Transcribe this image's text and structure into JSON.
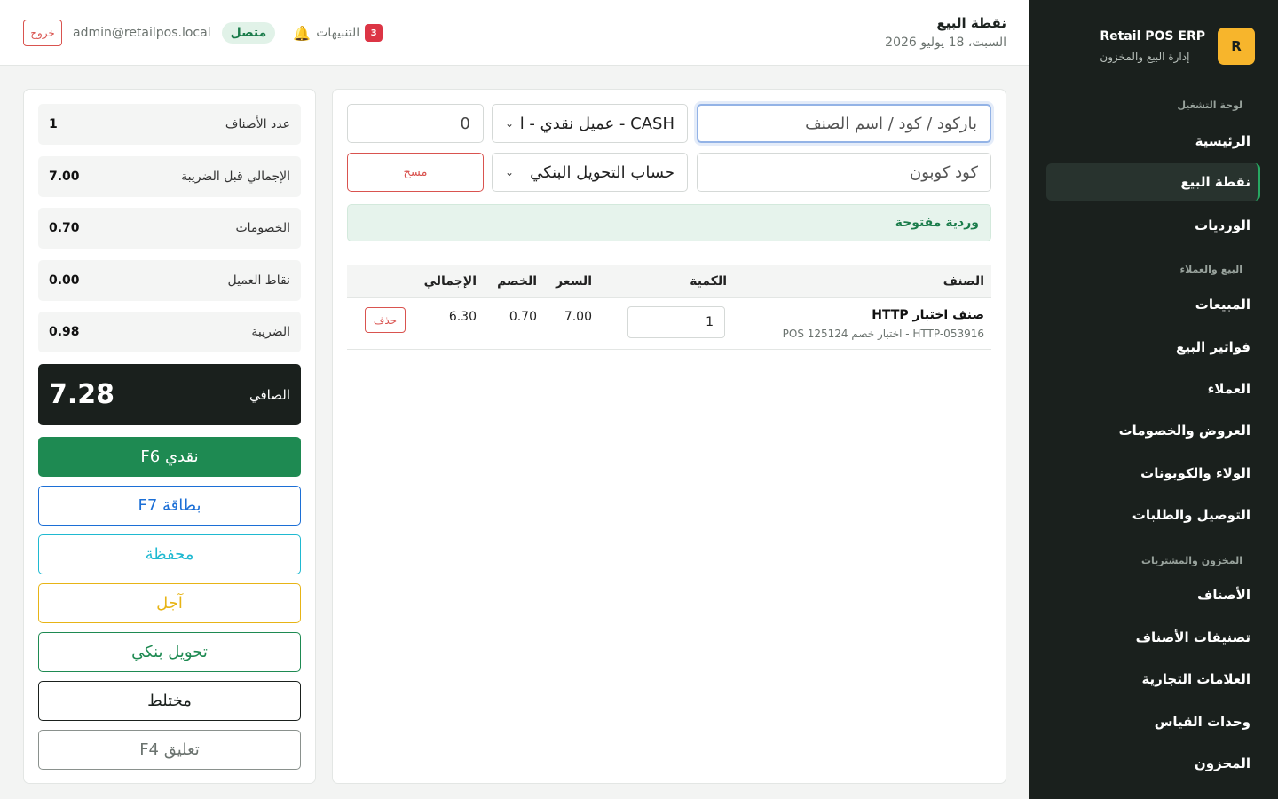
{
  "sidebar": {
    "brand_logo": "R",
    "brand_name": "Retail POS ERP",
    "brand_sub": "إدارة البيع والمخزون",
    "sections": {
      "dashboard": "لوحة التشغيل",
      "sales_customers": "البيع والعملاء",
      "inventory_purchases": "المخزون والمشتريات"
    },
    "items": [
      {
        "label": "الرئيسية"
      },
      {
        "label": "نقطة البيع"
      },
      {
        "label": "الورديات"
      },
      {
        "label": "المبيعات"
      },
      {
        "label": "فواتير البيع"
      },
      {
        "label": "العملاء"
      },
      {
        "label": "العروض والخصومات"
      },
      {
        "label": "الولاء والكوبونات"
      },
      {
        "label": "التوصيل والطلبات"
      },
      {
        "label": "الأصناف"
      },
      {
        "label": "تصنيفات الأصناف"
      },
      {
        "label": "العلامات التجارية"
      },
      {
        "label": "وحدات القياس"
      },
      {
        "label": "المخزون"
      }
    ],
    "active_item": "نقطة البيع",
    "accent": "#27a862"
  },
  "header": {
    "title": "نقطة البيع",
    "date": "السبت، 18 يوليو 2026",
    "alerts_label": "التنبيهات",
    "alerts_count": "3",
    "status": "متصل",
    "user_email": "admin@retailpos.local",
    "logout": "خروج"
  },
  "pos": {
    "barcode_placeholder": "باركود / كود / اسم الصنف",
    "customer_select": "CASH - عميل نقدي - ا",
    "amount_value": "0",
    "coupon_placeholder": "كود كوبون",
    "bank_account_select": "حساب التحويل البنكي",
    "clear_label": "مسح",
    "shift_status": "وردية مفتوحة"
  },
  "cart": {
    "columns": {
      "item": "الصنف",
      "qty": "الكمية",
      "price": "السعر",
      "discount": "الخصم",
      "total": "الإجمالي"
    },
    "rows": [
      {
        "name": "صنف اختبار HTTP",
        "sub": "HTTP-053916 - اختبار خصم POS 125124",
        "qty": "1",
        "price": "7.00",
        "discount": "0.70",
        "total": "6.30",
        "delete_label": "حذف"
      }
    ]
  },
  "summary": {
    "items_count": {
      "label": "عدد الأصناف",
      "value": "1"
    },
    "subtotal": {
      "label": "الإجمالي قبل الضريبة",
      "value": "7.00"
    },
    "discounts": {
      "label": "الخصومات",
      "value": "0.70"
    },
    "points": {
      "label": "نقاط العميل",
      "value": "0.00"
    },
    "tax": {
      "label": "الضريبة",
      "value": "0.98"
    },
    "net": {
      "label": "الصافي",
      "value": "7.28"
    }
  },
  "payments": {
    "cash": "نقدي F6",
    "card": "بطاقة F7",
    "wallet": "محفظة",
    "credit": "آجل",
    "bank": "تحويل بنكي",
    "mixed": "مختلط",
    "hold": "تعليق F4"
  },
  "colors": {
    "sidebar_bg": "#1a201d",
    "primary_green": "#1e8a52",
    "card_blue": "#1c6fd6",
    "wallet_cyan": "#1fb9d1",
    "credit_yellow": "#e7b416",
    "danger": "#d9534f"
  }
}
